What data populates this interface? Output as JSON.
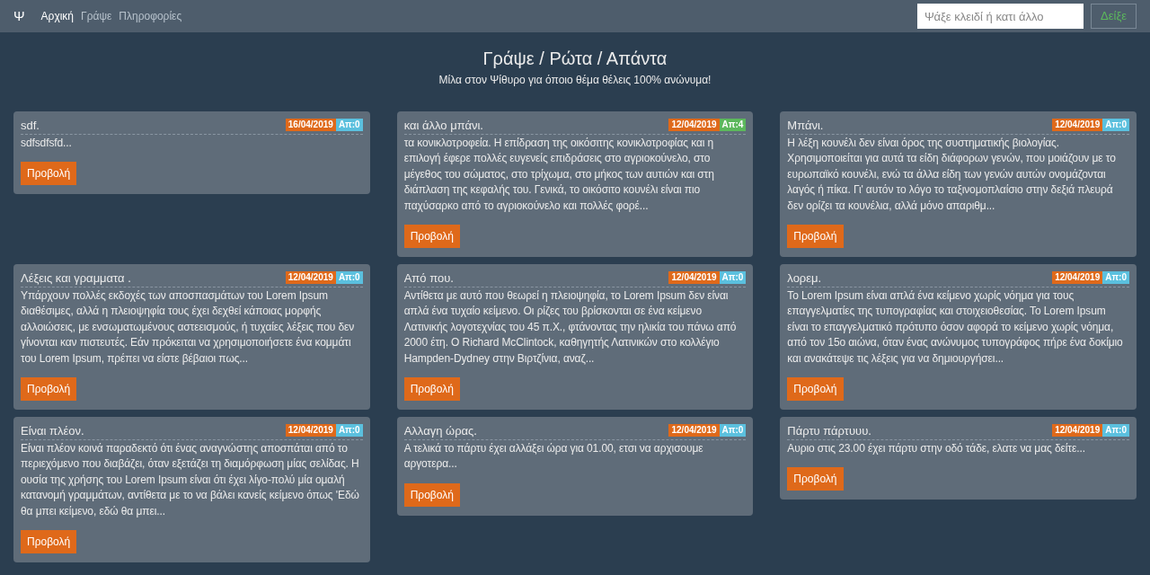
{
  "navbar": {
    "brand": "Ψ",
    "links": [
      {
        "label": "Αρχική",
        "selected": true
      },
      {
        "label": "Γράψε",
        "selected": false
      },
      {
        "label": "Πληροφορίες",
        "selected": false
      }
    ],
    "search": {
      "placeholder": "Ψάξε κλειδί ή κατι άλλο"
    },
    "search_button": "Δείξε"
  },
  "header": {
    "title": "Γράψε / Ρώτα / Απάντα",
    "subtitle": "Μίλα στον Ψίθυρο για όποιο θέμα θέλεις 100% ανώνυμα!"
  },
  "posts": [
    {
      "title": "sdf.",
      "date": "16/04/2019",
      "replies": {
        "label": "Απ:0",
        "color": "#5bc0de"
      },
      "excerpt": "sdfsdfsfd...",
      "button": "Προβολή"
    },
    {
      "title": "και άλλο μπάνι.",
      "date": "12/04/2019",
      "replies": {
        "label": "Απ:4",
        "color": "#5cb85c"
      },
      "excerpt": "τα κονικλοτροφεία. Η επίδραση της οικόσιτης κονικλοτροφίας και η επιλογή έφερε πολλές ευγενείς επιδράσεις στο αγριοκούνελο, στο μέγεθος του σώματος, στο τρίχωμα, στο μήκος των αυτιών και στη διάπλαση της κεφαλής του. Γενικά, το οικόσιτο κουνέλι είναι πιο παχύσαρκο από το αγριοκούνελο και πολλές φορέ...",
      "button": "Προβολή"
    },
    {
      "title": "Μπάνι.",
      "date": "12/04/2019",
      "replies": {
        "label": "Απ:0",
        "color": "#5bc0de"
      },
      "excerpt": "Η λέξη κουνέλι δεν είναι όρος της συστηματικής βιολογίας. Χρησιμοποιείται για αυτά τα είδη διάφορων γενών, που μοιάζουν με το ευρωπαϊκό κουνέλι, ενώ τα άλλα είδη των γενών αυτών ονομάζονται λαγός ή πίκα. Γι' αυτόν το λόγο το ταξινομοπλαίσιο στην δεξιά πλευρά δεν ορίζει τα κουνέλια, αλλά μόνο απαριθμ...",
      "button": "Προβολή"
    },
    {
      "title": "Λέξεις και γραμματα .",
      "date": "12/04/2019",
      "replies": {
        "label": "Απ:0",
        "color": "#5bc0de"
      },
      "excerpt": "Υπάρχουν πολλές εκδοχές των αποσπασμάτων του Lorem Ipsum διαθέσιμες, αλλά η πλειοψηφία τους έχει δεχθεί κάποιας μορφής αλλοιώσεις, με ενσωματωμένους αστεεισμούς, ή τυχαίες λέξεις που δεν γίνονται καν πιστευτές. Εάν πρόκειται να χρησιμοποιήσετε ένα κομμάτι του Lorem Ipsum, πρέπει να είστε βέβαιοι πως...",
      "button": "Προβολή"
    },
    {
      "title": "Από που.",
      "date": "12/04/2019",
      "replies": {
        "label": "Απ:0",
        "color": "#5bc0de"
      },
      "excerpt": "Αντίθετα με αυτό που θεωρεί η πλειοψηφία, το Lorem Ipsum δεν είναι απλά ένα τυχαίο κείμενο. Οι ρίζες του βρίσκονται σε ένα κείμενο Λατινικής λογοτεχνίας του 45 π.Χ., φτάνοντας την ηλικία του πάνω από 2000 έτη. Ο Richard McClintock, καθηγητής Λατινικών στο κολλέγιο Hampden-Dydney στην Βιρτζίνια, αναζ...",
      "button": "Προβολή"
    },
    {
      "title": "λορεμ.",
      "date": "12/04/2019",
      "replies": {
        "label": "Απ:0",
        "color": "#5bc0de"
      },
      "excerpt": "Το Lorem Ipsum είναι απλά ένα κείμενο χωρίς νόημα για τους επαγγελματίες της τυπογραφίας και στοιχειοθεσίας. Το Lorem Ipsum είναι το επαγγελματικό πρότυπο όσον αφορά το κείμενο χωρίς νόημα, από τον 15ο αιώνα, όταν ένας ανώνυμος τυπογράφος πήρε ένα δοκίμιο και ανακάτεψε τις λέξεις για να δημιουργήσει...",
      "button": "Προβολή"
    },
    {
      "title": "Είναι πλέον.",
      "date": "12/04/2019",
      "replies": {
        "label": "Απ:0",
        "color": "#5bc0de"
      },
      "excerpt": "Είναι πλέον κοινά παραδεκτό ότι ένας αναγνώστης αποσπάται από το περιεχόμενο που διαβάζει, όταν εξετάζει τη διαμόρφωση μίας σελίδας. Η ουσία της χρήσης του Lorem Ipsum είναι ότι έχει λίγο-πολύ μία ομαλή κατανομή γραμμάτων, αντίθετα με το να βάλει κανείς κείμενο όπως 'Εδώ θα μπει κείμενο, εδώ θα μπει...",
      "button": "Προβολή"
    },
    {
      "title": "Αλλαγη ώρας.",
      "date": "12/04/2019",
      "replies": {
        "label": "Απ:0",
        "color": "#5bc0de"
      },
      "excerpt": "Α τελικά το πάρτυ έχει αλλάξει ώρα για 01.00, ετσι να αρχισουμε αργοτερα...",
      "button": "Προβολή"
    },
    {
      "title": "Πάρτυ πάρτυυυ.",
      "date": "12/04/2019",
      "replies": {
        "label": "Απ:0",
        "color": "#5bc0de"
      },
      "excerpt": "Αυριο στις 23.00 έχει πάρτυ στην οδό τάδε, ελατε να μας δείτε...",
      "button": "Προβολή"
    }
  ]
}
